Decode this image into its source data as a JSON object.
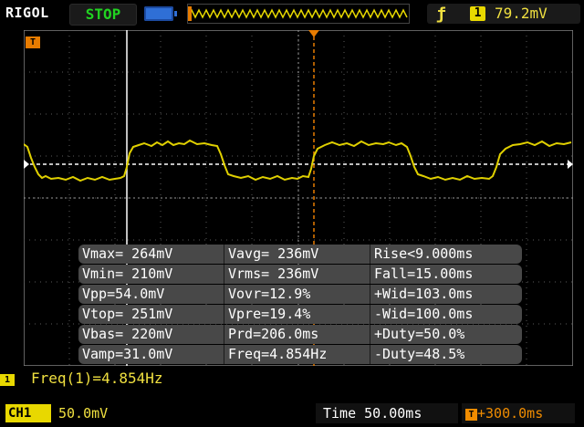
{
  "header": {
    "brand": "RIGOL",
    "run_status": "STOP",
    "trigger_edge_glyph": "ƒ",
    "trigger_source": "1",
    "trigger_level": "79.2mV"
  },
  "markers": {
    "trigger_position": "T",
    "channel1": "1"
  },
  "measurements": [
    [
      "Vmax= 264mV",
      "Vavg= 236mV",
      "Rise<9.000ms"
    ],
    [
      "Vmin= 210mV",
      "Vrms= 236mV",
      "Fall=15.00ms"
    ],
    [
      "Vpp=54.0mV",
      "Vovr=12.9%",
      "+Wid=103.0ms"
    ],
    [
      "Vtop= 251mV",
      "Vpre=19.4%",
      "-Wid=100.0ms"
    ],
    [
      "Vbas= 220mV",
      "Prd=206.0ms",
      "+Duty=50.0%"
    ],
    [
      "Vamp=31.0mV",
      "Freq=4.854Hz",
      "-Duty=48.5%"
    ]
  ],
  "frequency_readout": "Freq(1)=4.854Hz",
  "footer": {
    "channel_label": "CH1",
    "channel_scale": "50.0mV",
    "timebase": "Time 50.00ms",
    "trigger_offset": "+300.0ms"
  },
  "colors": {
    "channel1": "#e8d800",
    "trigger": "#e87c00",
    "run_status": "#21d321"
  }
}
